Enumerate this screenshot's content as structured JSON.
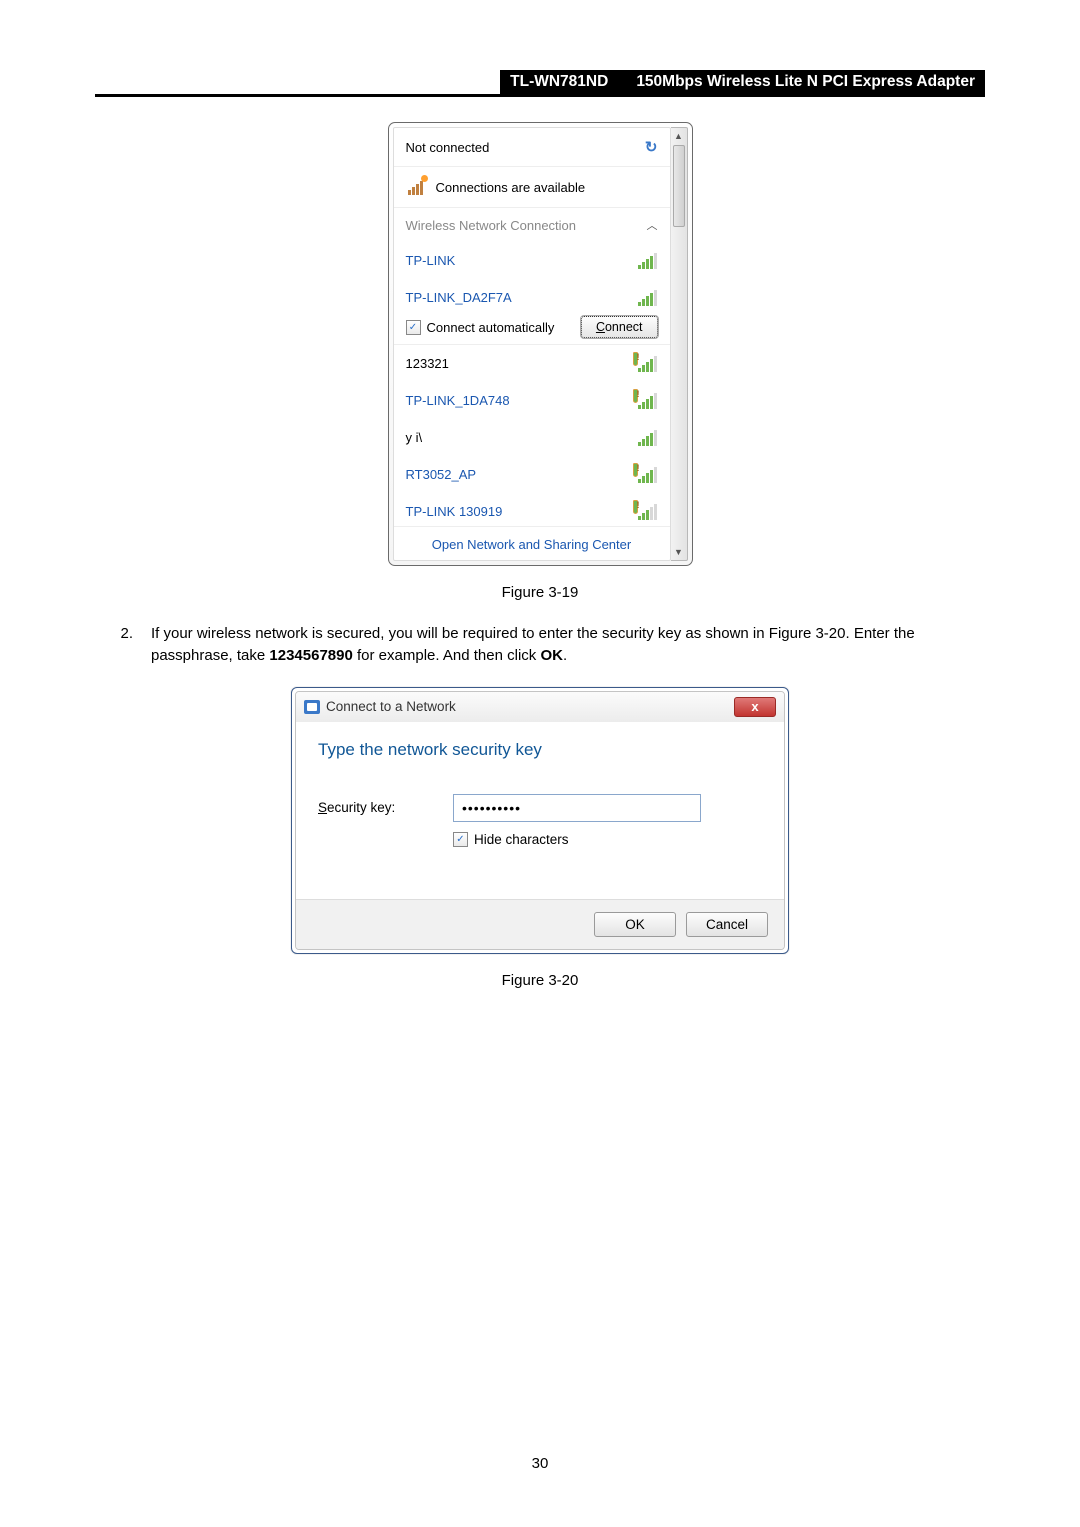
{
  "header": {
    "model": "TL-WN781ND",
    "description": "150Mbps Wireless Lite N PCI Express Adapter"
  },
  "wifi_flyout": {
    "status": "Not connected",
    "available_msg": "Connections are available",
    "section_title": "Wireless Network Connection",
    "networks": [
      {
        "name": "TP-LINK",
        "secured": false,
        "strength": "mid"
      },
      {
        "name": "TP-LINK_DA2F7A",
        "secured": false,
        "strength": "mid",
        "expanded": true
      },
      {
        "name": "123321",
        "secured": true,
        "strength": "mid"
      },
      {
        "name": "TP-LINK_1DA748",
        "secured": true,
        "strength": "mid"
      },
      {
        "name": "у і\\",
        "secured": false,
        "strength": "mid"
      },
      {
        "name": "RT3052_AP",
        "secured": true,
        "strength": "mid"
      },
      {
        "name": "TP-LINK 130919",
        "secured": true,
        "strength": "weak"
      }
    ],
    "connect_auto_label": "Connect automatically",
    "connect_btn": "Connect",
    "footer_link": "Open Network and Sharing Center"
  },
  "figure1_caption": "Figure 3-19",
  "step": {
    "number": "2.",
    "line1_a": "If your wireless network is secured, you will be required to enter the security key as shown in Figure 3-20. Enter the passphrase, take ",
    "line1_b": "1234567890",
    "line1_c": " for example. And then click ",
    "line1_d": "OK",
    "line1_e": "."
  },
  "security_dialog": {
    "title": "Connect to a Network",
    "heading": "Type the network security key",
    "label_prefix": "S",
    "label_rest": "ecurity key:",
    "input_value": "••••••••••",
    "hide_prefix": "H",
    "hide_rest": "ide characters",
    "ok": "OK",
    "cancel": "Cancel"
  },
  "figure2_caption": "Figure 3-20",
  "page_number": "30"
}
